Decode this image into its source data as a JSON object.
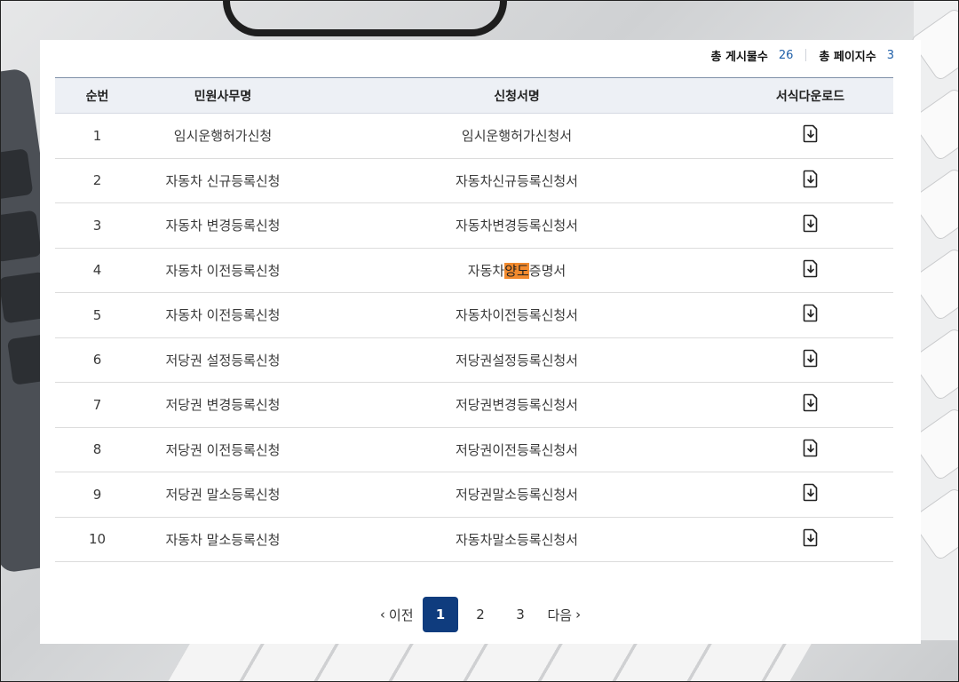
{
  "summary": {
    "total_posts_label": "총 게시물수",
    "total_posts": "26",
    "total_pages_label": "총 페이지수",
    "total_pages": "3"
  },
  "table": {
    "headers": [
      "순번",
      "민원사무명",
      "신청서명",
      "서식다운로드"
    ],
    "rows": [
      {
        "no": "1",
        "task": "임시운행허가신청",
        "form": "임시운행허가신청서"
      },
      {
        "no": "2",
        "task": "자동차 신규등록신청",
        "form": "자동차신규등록신청서"
      },
      {
        "no": "3",
        "task": "자동차 변경등록신청",
        "form": "자동차변경등록신청서"
      },
      {
        "no": "4",
        "task": "자동차 이전등록신청",
        "form_pre": "자동차",
        "form_hl": "양도",
        "form_post": "증명서"
      },
      {
        "no": "5",
        "task": "자동차 이전등록신청",
        "form": "자동차이전등록신청서"
      },
      {
        "no": "6",
        "task": "저당권 설정등록신청",
        "form": "저당권설정등록신청서"
      },
      {
        "no": "7",
        "task": "저당권 변경등록신청",
        "form": "저당권변경등록신청서"
      },
      {
        "no": "8",
        "task": "저당권 이전등록신청",
        "form": "저당권이전등록신청서"
      },
      {
        "no": "9",
        "task": "저당권 말소등록신청",
        "form": "저당권말소등록신청서"
      },
      {
        "no": "10",
        "task": "자동차 말소등록신청",
        "form": "자동차말소등록신청서"
      }
    ],
    "download_icon": "file-download-icon"
  },
  "pagination": {
    "prev": "이전",
    "pages": [
      "1",
      "2",
      "3"
    ],
    "current": "1",
    "next": "다음"
  },
  "colors": {
    "accent": "#0f3c7e",
    "highlight": "#f28a2e",
    "count": "#1f5fa8"
  }
}
